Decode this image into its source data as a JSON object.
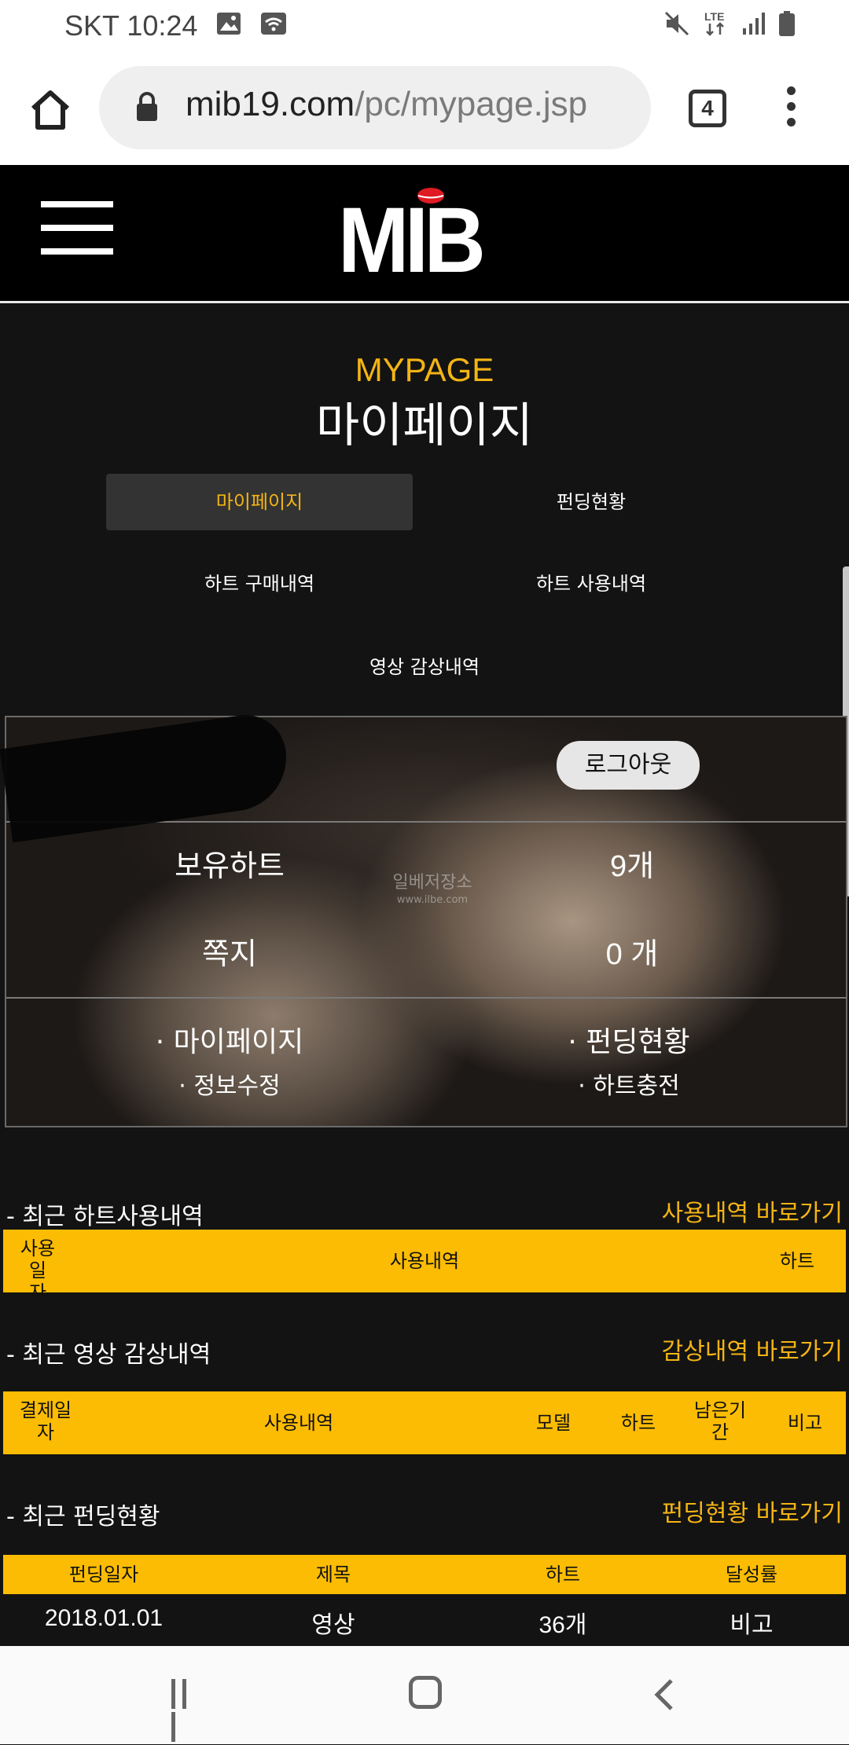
{
  "status_bar": {
    "carrier_time": "SKT 10:24",
    "icons": [
      "image-icon",
      "wifi-icon",
      "mute-icon",
      "lte-icon",
      "signal-icon",
      "battery-icon"
    ],
    "lte_label": "LTE"
  },
  "browser": {
    "url_domain": "mib19.com",
    "url_path": "/pc/mypage.jsp",
    "tab_count": "4"
  },
  "header": {
    "logo_text": "MIB"
  },
  "page": {
    "title_en": "MYPAGE",
    "title_ko": "마이페이지"
  },
  "tabs": [
    {
      "label": "마이페이지",
      "active": true
    },
    {
      "label": "펀딩현황",
      "active": false
    },
    {
      "label": "하트 구매내역",
      "active": false
    },
    {
      "label": "하트 사용내역",
      "active": false
    },
    {
      "label": "영상 감상내역",
      "active": false
    }
  ],
  "profile": {
    "logout_label": "로그아웃",
    "hearts_label": "보유하트",
    "hearts_value": "9개",
    "messages_label": "쪽지",
    "messages_value": "0 개",
    "watermark_main": "일베저장소",
    "watermark_sub": "www.ilbe.com",
    "links": [
      "· 마이페이지",
      "· 펀딩현황",
      "· 정보수정",
      "· 하트충전"
    ]
  },
  "sections": {
    "heart_usage": {
      "title": "- 최근 하트사용내역",
      "link": "사용내역 바로가기",
      "columns": [
        "사용일\n자",
        "사용내역",
        "하트"
      ]
    },
    "video_history": {
      "title": "- 최근 영상 감상내역",
      "link": "감상내역 바로가기",
      "columns": [
        "결제일\n자",
        "사용내역",
        "모델",
        "하트",
        "남은기\n간",
        "비고"
      ]
    },
    "funding": {
      "title": "- 최근 펀딩현황",
      "link": "펀딩현황 바로가기",
      "columns": [
        "펀딩일자",
        "제목",
        "하트",
        "달성률"
      ],
      "rows": [
        [
          "2018.01.01",
          "영상",
          "36개",
          "비고"
        ]
      ]
    }
  },
  "colors": {
    "accent": "#f3b414",
    "table_header": "#fbbc03",
    "background": "#131313"
  }
}
